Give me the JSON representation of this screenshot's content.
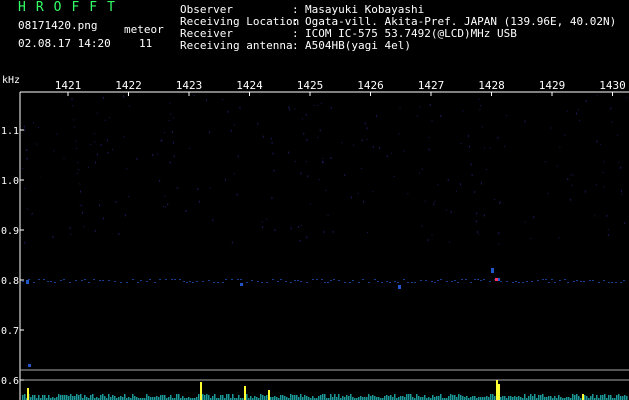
{
  "header": {
    "app_title": "HROFFT",
    "filename": "08171420.png",
    "timestamp": "02.08.17 14:20",
    "count_label": "meteor",
    "count_value": "11",
    "info": [
      {
        "key": "Observer",
        "sep": ":",
        "value": "Masayuki Kobayashi"
      },
      {
        "key": "Receiving Location",
        "sep": ":",
        "value": "Ogata-vill. Akita-Pref. JAPAN (139.96E, 40.02N)"
      },
      {
        "key": "Receiver",
        "sep": ":",
        "value": "ICOM IC-575 53.7492(@LCD)MHz USB"
      },
      {
        "key": "Receiving antenna",
        "sep": ":",
        "value": "A504HB(yagi 4el)"
      }
    ]
  },
  "spectrogram": {
    "y_unit": "kHz",
    "y_ticks": [
      "1.1",
      "1.0",
      "0.9",
      "0.8",
      "0.7",
      "0.6"
    ],
    "x_ticks": [
      "1421",
      "1422",
      "1423",
      "1424",
      "1425",
      "1426",
      "1427",
      "1428",
      "1429",
      "1430"
    ],
    "colors": {
      "background": "#000000",
      "noise": "#1a1a5a",
      "signal": "#2255cc",
      "axis": "#ffffff",
      "trace": "#1c9a9a",
      "meteor_tick": "#ffff33",
      "hot": "#ff3366"
    }
  }
}
